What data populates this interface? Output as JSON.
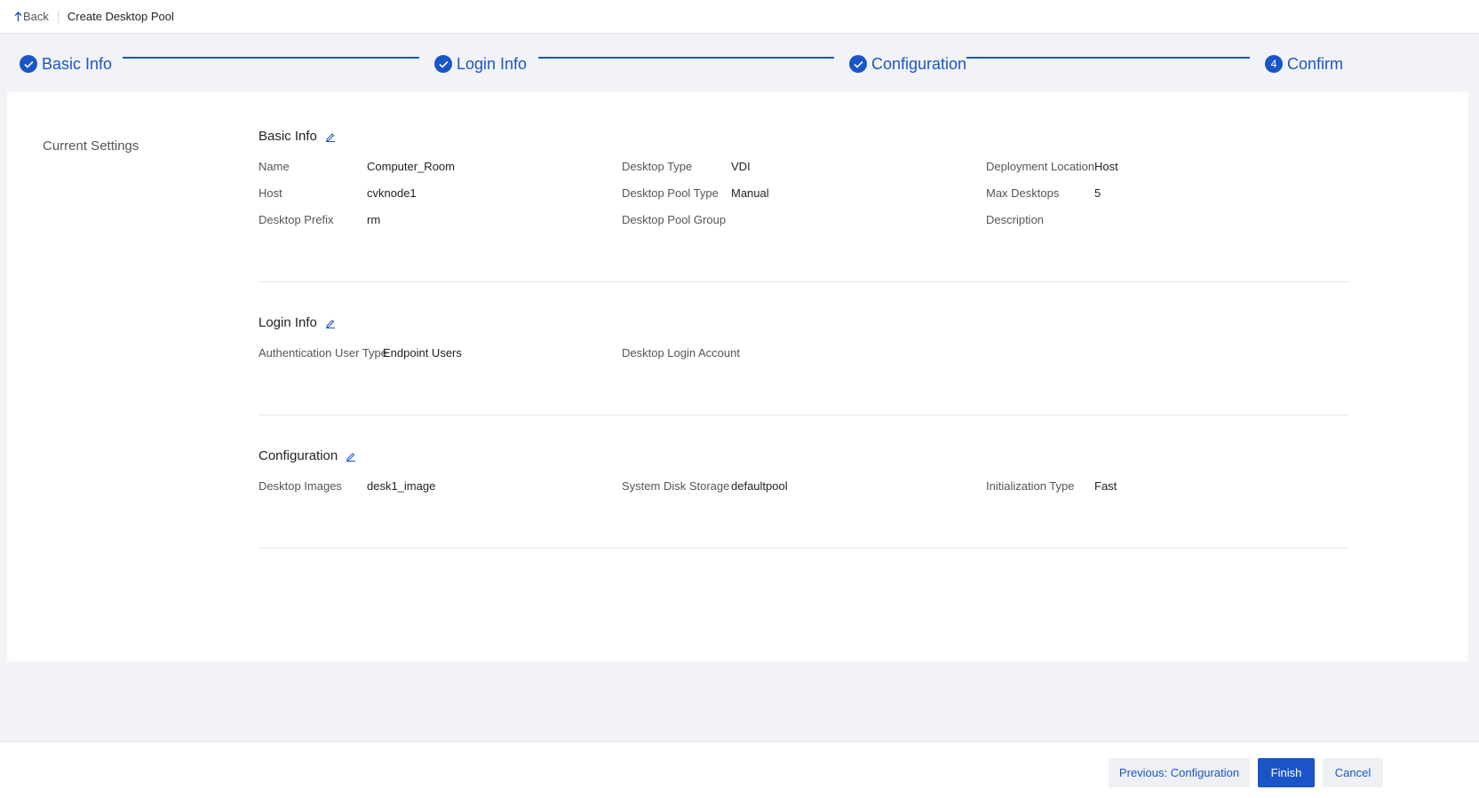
{
  "header": {
    "back_label": "Back",
    "title": "Create Desktop Pool"
  },
  "stepper": {
    "steps": [
      {
        "label": "Basic Info",
        "status": "done"
      },
      {
        "label": "Login Info",
        "status": "done"
      },
      {
        "label": "Configuration",
        "status": "done"
      },
      {
        "label": "Confirm",
        "status": "current",
        "number": "4"
      }
    ],
    "accent_color": "#1a55c8"
  },
  "main": {
    "sidebar_label": "Current Settings",
    "sections": {
      "basic": {
        "title": "Basic Info",
        "fields": [
          {
            "label": "Name",
            "value": "Computer_Room"
          },
          {
            "label": "Desktop Type",
            "value": "VDI"
          },
          {
            "label": "Deployment Location",
            "value": "Host"
          },
          {
            "label": "Host",
            "value": "cvknode1"
          },
          {
            "label": "Desktop Pool Type",
            "value": "Manual"
          },
          {
            "label": "Max Desktops",
            "value": "5"
          },
          {
            "label": "Desktop Prefix",
            "value": "rm"
          },
          {
            "label": "Desktop Pool Group",
            "value": ""
          },
          {
            "label": "Description",
            "value": ""
          }
        ]
      },
      "login": {
        "title": "Login Info",
        "fields": [
          {
            "label": "Authentication User Type",
            "value": "Endpoint Users"
          },
          {
            "label": "Desktop Login Account",
            "value": ""
          }
        ]
      },
      "config": {
        "title": "Configuration",
        "fields": [
          {
            "label": "Desktop Images",
            "value": "desk1_image"
          },
          {
            "label": "System Disk Storage",
            "value": "defaultpool"
          },
          {
            "label": "Initialization Type",
            "value": "Fast"
          }
        ]
      }
    }
  },
  "footer": {
    "previous_label": "Previous: Configuration",
    "finish_label": "Finish",
    "cancel_label": "Cancel"
  }
}
